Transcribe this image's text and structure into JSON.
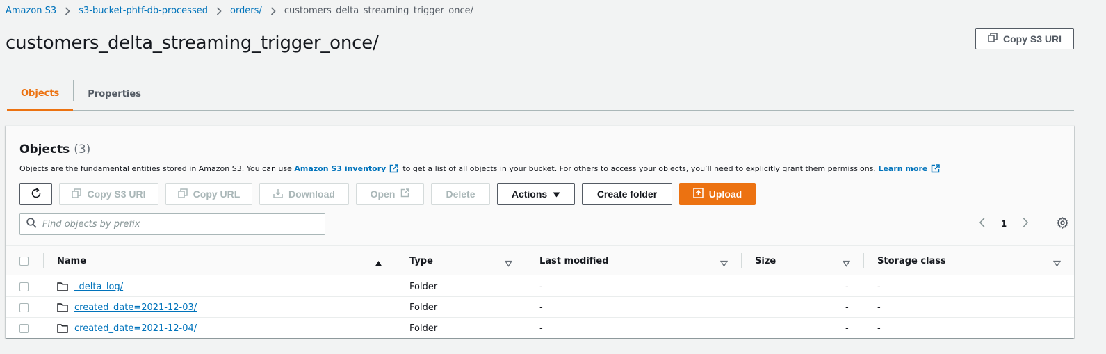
{
  "breadcrumb": [
    {
      "label": "Amazon S3"
    },
    {
      "label": "s3-bucket-phtf-db-processed"
    },
    {
      "label": "orders/"
    },
    {
      "label": "customers_delta_streaming_trigger_once/"
    }
  ],
  "page": {
    "title": "customers_delta_streaming_trigger_once/",
    "copy_uri_label": "Copy S3 URI"
  },
  "tabs": [
    {
      "label": "Objects",
      "active": true
    },
    {
      "label": "Properties",
      "active": false
    }
  ],
  "objects_panel": {
    "title": "Objects",
    "count": "(3)",
    "description": {
      "text1": "Objects are the fundamental entities stored in Amazon S3. You can use",
      "link1": "Amazon S3 inventory",
      "text2": "to get a list of all objects in your bucket. For others to access your objects, you’ll need to explicitly grant them permissions.",
      "link2": "Learn more"
    },
    "toolbar": {
      "copy_s3_uri": "Copy S3 URI",
      "copy_url": "Copy URL",
      "download": "Download",
      "open": "Open",
      "delete": "Delete",
      "actions": "Actions",
      "create_folder": "Create folder",
      "upload": "Upload"
    },
    "search_placeholder": "Find objects by prefix",
    "pagination": {
      "current_page": "1"
    },
    "columns": [
      "Name",
      "Type",
      "Last modified",
      "Size",
      "Storage class"
    ],
    "rows": [
      {
        "name": "_delta_log/",
        "type": "Folder",
        "last_modified": "-",
        "size": "-",
        "storage_class": "-"
      },
      {
        "name": "created_date=2021-12-03/",
        "type": "Folder",
        "last_modified": "-",
        "size": "-",
        "storage_class": "-"
      },
      {
        "name": "created_date=2021-12-04/",
        "type": "Folder",
        "last_modified": "-",
        "size": "-",
        "storage_class": "-"
      }
    ]
  },
  "colors": {
    "link": "#0073bb",
    "accent": "#ec7211",
    "text": "#16191f",
    "background": "#f2f3f3"
  },
  "icons": [
    "chevron-right-icon",
    "copy-icon",
    "refresh-icon",
    "download-icon",
    "external-link-icon",
    "caret-down-icon",
    "upload-icon",
    "search-icon",
    "chevron-left-icon",
    "gear-icon",
    "folder-icon",
    "sort-ascending-icon",
    "sort-icon"
  ]
}
